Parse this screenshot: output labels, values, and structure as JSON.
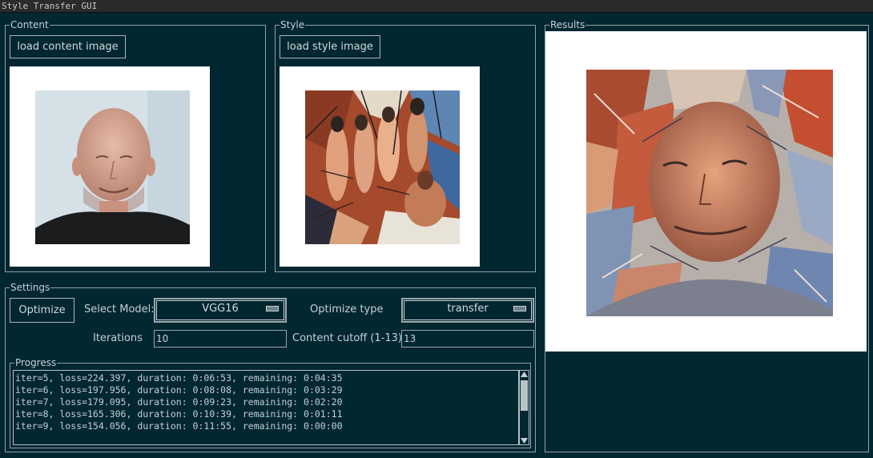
{
  "window": {
    "title": "Style Transfer GUI"
  },
  "content": {
    "label": "Content",
    "load_button": "load content image",
    "image_icon": "portrait-photo"
  },
  "style": {
    "label": "Style",
    "load_button": "load style image",
    "image_icon": "cubist-painting"
  },
  "results": {
    "label": "Results",
    "image_icon": "stylized-portrait"
  },
  "settings": {
    "label": "Settings",
    "optimize_button": "Optimize",
    "select_model_label": "Select Model:",
    "model_value": "VGG16",
    "optimize_type_label": "Optimize type",
    "optimize_type_value": "transfer",
    "iterations_label": "Iterations",
    "iterations_value": "10",
    "content_cutoff_label": "Content cutoff (1-13)",
    "content_cutoff_value": "13"
  },
  "progress": {
    "label": "Progress",
    "lines": [
      "iter=5, loss=224.397, duration: 0:06:53, remaining: 0:04:35",
      "iter=6, loss=197.956, duration: 0:08:08, remaining: 0:03:29",
      "iter=7, loss=179.095, duration: 0:09:23, remaining: 0:02:20",
      "iter=8, loss=165.306, duration: 0:10:39, remaining: 0:01:11",
      "iter=9, loss=154.056, duration: 0:11:55, remaining: 0:00:00"
    ]
  },
  "colors": {
    "background": "#012731",
    "frame": "#90a3aa",
    "text": "#c5d0d4"
  }
}
